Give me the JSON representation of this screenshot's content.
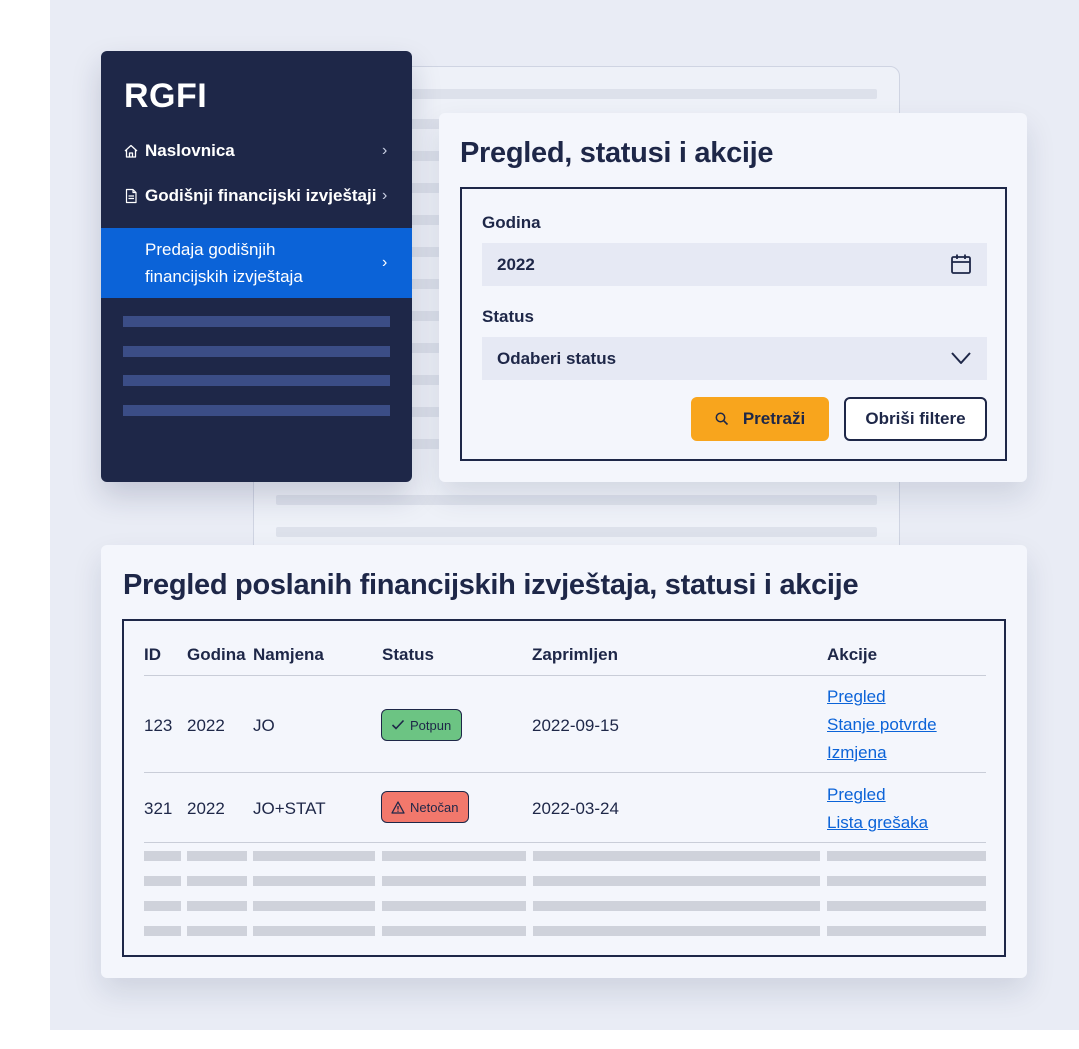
{
  "sidebar": {
    "brand": "RGFI",
    "items": [
      {
        "label": "Naslovnica",
        "icon": "home-icon"
      },
      {
        "label": "Godišnji financijski izvještaji",
        "icon": "document-icon"
      },
      {
        "label": "Predaja godišnjih financijskih izvještaja",
        "active": true
      }
    ]
  },
  "filter": {
    "title": "Pregled, statusi i akcije",
    "year_label": "Godina",
    "year_value": "2022",
    "status_label": "Status",
    "status_value": "Odaberi status",
    "search_label": "Pretraži",
    "clear_label": "Obriši filtere"
  },
  "table": {
    "title": "Pregled poslanih financijskih izvještaja, statusi i akcije",
    "headers": [
      "ID",
      "Godina",
      "Namjena",
      "Status",
      "Zaprimljen",
      "Akcije"
    ],
    "rows": [
      {
        "id": "123",
        "year": "2022",
        "purpose": "JO",
        "status": "Potpun",
        "status_kind": "ok",
        "received": "2022-09-15",
        "actions": [
          "Pregled",
          "Stanje potvrde",
          "Izmjena"
        ]
      },
      {
        "id": "321",
        "year": "2022",
        "purpose": "JO+STAT",
        "status": "Netočan",
        "status_kind": "error",
        "received": "2022-03-24",
        "actions": [
          "Pregled",
          "Lista grešaka"
        ]
      }
    ]
  },
  "colors": {
    "navy": "#1e2748",
    "accent_blue": "#0b63d8",
    "search_orange": "#f8a51d",
    "status_ok": "#6cc483",
    "status_error": "#f2786c"
  }
}
